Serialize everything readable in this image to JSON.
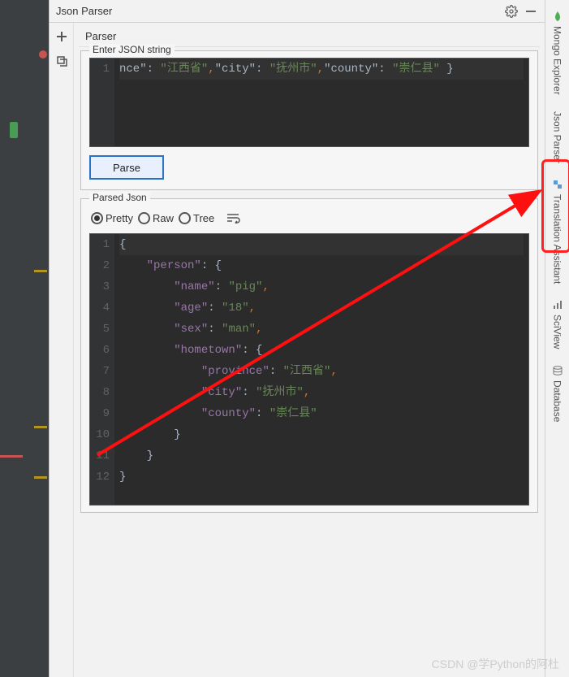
{
  "panel": {
    "title": "Json Parser",
    "sub_header": "Parser",
    "input_legend": "Enter JSON string",
    "parse_button": "Parse",
    "parsed_legend": "Parsed Json"
  },
  "radios": {
    "pretty": "Pretty",
    "raw": "Raw",
    "tree": "Tree"
  },
  "input_editor": {
    "lines": [
      "1"
    ],
    "content_parts": [
      {
        "t": "plain",
        "v": "nce\": "
      },
      {
        "t": "str",
        "v": "\"江西省\""
      },
      {
        "t": "punc",
        "v": ","
      },
      {
        "t": "plain",
        "v": "\"city\": "
      },
      {
        "t": "str",
        "v": "\"抚州市\""
      },
      {
        "t": "punc",
        "v": ","
      },
      {
        "t": "plain",
        "v": "\"county\": "
      },
      {
        "t": "str",
        "v": "\"崇仁县\""
      },
      {
        "t": "plain",
        "v": " }"
      }
    ]
  },
  "parsed_editor": {
    "lines": [
      "1",
      "2",
      "3",
      "4",
      "5",
      "6",
      "7",
      "8",
      "9",
      "10",
      "11",
      "12"
    ],
    "rows": [
      [
        {
          "t": "brace",
          "v": "{"
        }
      ],
      [
        {
          "t": "pad",
          "v": "    "
        },
        {
          "t": "key",
          "v": "\"person\""
        },
        {
          "t": "plain",
          "v": ": "
        },
        {
          "t": "brace",
          "v": "{"
        }
      ],
      [
        {
          "t": "pad",
          "v": "        "
        },
        {
          "t": "key",
          "v": "\"name\""
        },
        {
          "t": "plain",
          "v": ": "
        },
        {
          "t": "str",
          "v": "\"pig\""
        },
        {
          "t": "punc",
          "v": ","
        }
      ],
      [
        {
          "t": "pad",
          "v": "        "
        },
        {
          "t": "key",
          "v": "\"age\""
        },
        {
          "t": "plain",
          "v": ": "
        },
        {
          "t": "str",
          "v": "\"18\""
        },
        {
          "t": "punc",
          "v": ","
        }
      ],
      [
        {
          "t": "pad",
          "v": "        "
        },
        {
          "t": "key",
          "v": "\"sex\""
        },
        {
          "t": "plain",
          "v": ": "
        },
        {
          "t": "str",
          "v": "\"man\""
        },
        {
          "t": "punc",
          "v": ","
        }
      ],
      [
        {
          "t": "pad",
          "v": "        "
        },
        {
          "t": "key",
          "v": "\"hometown\""
        },
        {
          "t": "plain",
          "v": ": "
        },
        {
          "t": "brace",
          "v": "{"
        }
      ],
      [
        {
          "t": "pad",
          "v": "            "
        },
        {
          "t": "key",
          "v": "\"province\""
        },
        {
          "t": "plain",
          "v": ": "
        },
        {
          "t": "str",
          "v": "\"江西省\""
        },
        {
          "t": "punc",
          "v": ","
        }
      ],
      [
        {
          "t": "pad",
          "v": "            "
        },
        {
          "t": "key",
          "v": "\"city\""
        },
        {
          "t": "plain",
          "v": ": "
        },
        {
          "t": "str",
          "v": "\"抚州市\""
        },
        {
          "t": "punc",
          "v": ","
        }
      ],
      [
        {
          "t": "pad",
          "v": "            "
        },
        {
          "t": "key",
          "v": "\"county\""
        },
        {
          "t": "plain",
          "v": ": "
        },
        {
          "t": "str",
          "v": "\"崇仁县\""
        }
      ],
      [
        {
          "t": "pad",
          "v": "        "
        },
        {
          "t": "brace",
          "v": "}"
        }
      ],
      [
        {
          "t": "pad",
          "v": "    "
        },
        {
          "t": "brace",
          "v": "}"
        }
      ],
      [
        {
          "t": "brace",
          "v": "}"
        }
      ]
    ]
  },
  "right_tabs": {
    "mongo": "Mongo Explorer",
    "json_parser": "Json Parser",
    "translation": "Translation Assistant",
    "sciview": "SciView",
    "database": "Database"
  },
  "watermark": "CSDN @学Python的阿杜"
}
